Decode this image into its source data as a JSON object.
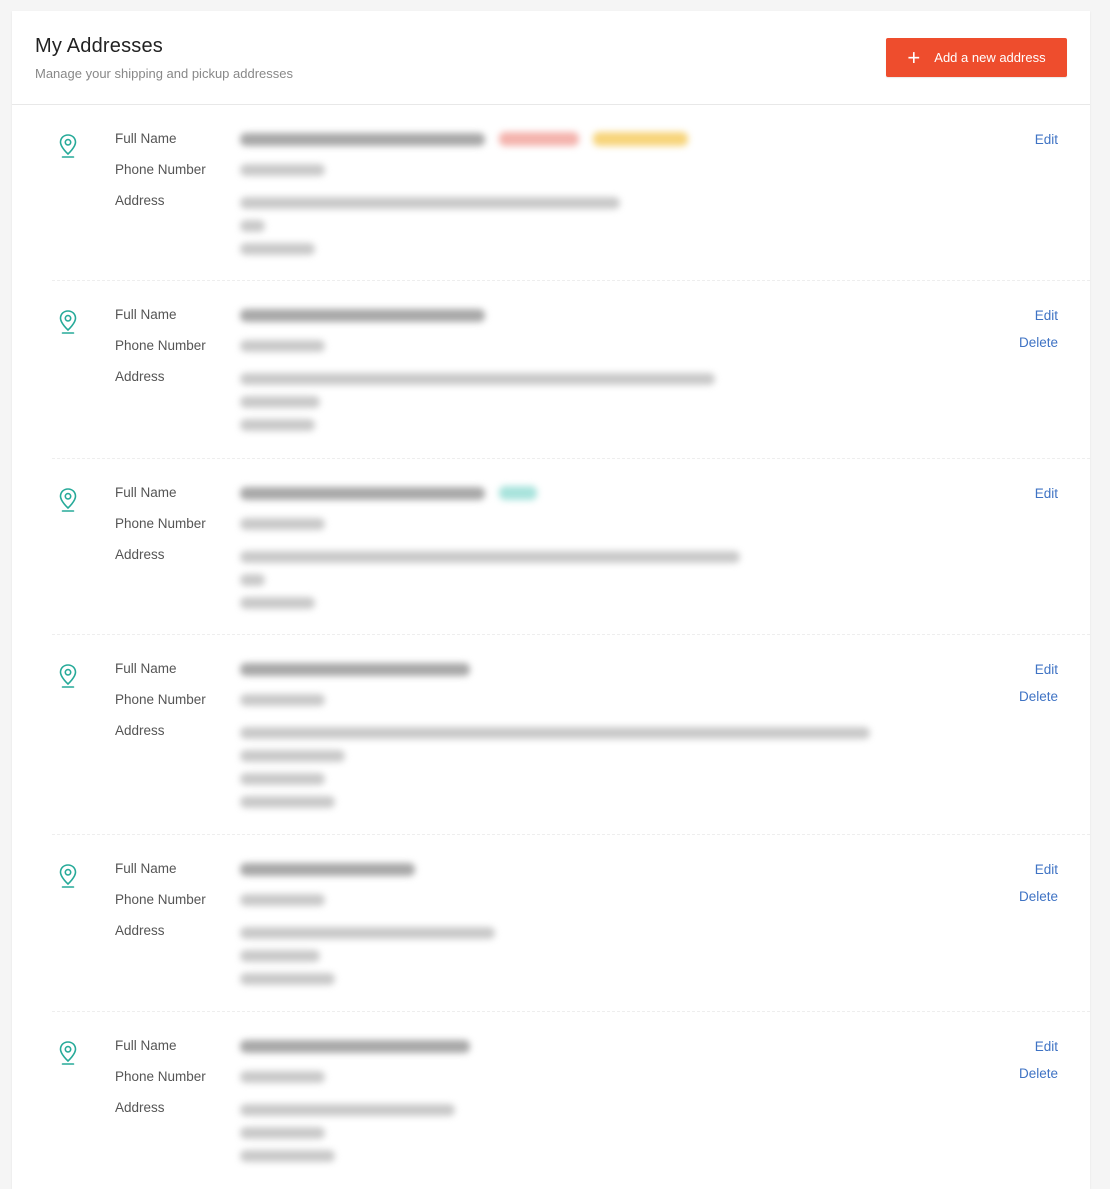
{
  "header": {
    "title": "My Addresses",
    "subtitle": "Manage your shipping and pickup addresses",
    "add_button_label": "Add a new address",
    "add_button_icon": "plus-icon"
  },
  "colors": {
    "accent": "#ee4d2d",
    "link": "#3f73c4",
    "pin": "#26aa99"
  },
  "field_labels": {
    "full_name": "Full Name",
    "phone": "Phone Number",
    "address": "Address"
  },
  "actions": {
    "edit": "Edit",
    "delete": "Delete"
  },
  "addresses": [
    {
      "has_delete": false,
      "name_blurred": true,
      "phone_blurred": true,
      "address_lines_blurred": 3,
      "badges": [
        "red",
        "yellow"
      ]
    },
    {
      "has_delete": true,
      "name_blurred": true,
      "phone_blurred": true,
      "address_lines_blurred": 3,
      "badges": []
    },
    {
      "has_delete": false,
      "name_blurred": true,
      "phone_blurred": true,
      "address_lines_blurred": 3,
      "badges": [
        "teal"
      ]
    },
    {
      "has_delete": true,
      "name_blurred": true,
      "phone_blurred": true,
      "address_lines_blurred": 4,
      "badges": []
    },
    {
      "has_delete": true,
      "name_blurred": true,
      "phone_blurred": true,
      "address_lines_blurred": 3,
      "badges": []
    },
    {
      "has_delete": true,
      "name_blurred": true,
      "phone_blurred": true,
      "address_lines_blurred": 3,
      "badges": []
    }
  ]
}
